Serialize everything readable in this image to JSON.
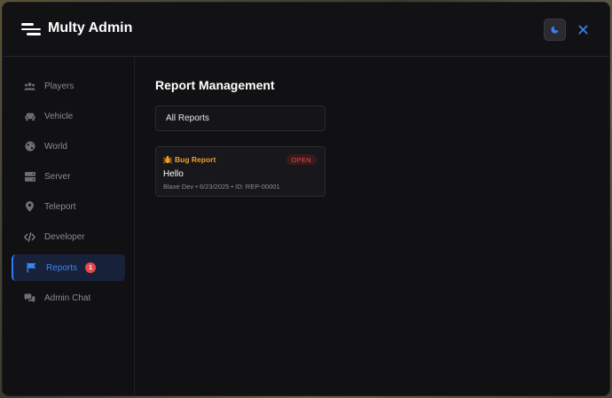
{
  "app": {
    "title": "Multy Admin"
  },
  "sidebar": {
    "items": [
      {
        "label": "Players",
        "icon": "users-icon"
      },
      {
        "label": "Vehicle",
        "icon": "car-icon"
      },
      {
        "label": "World",
        "icon": "globe-icon"
      },
      {
        "label": "Server",
        "icon": "server-icon"
      },
      {
        "label": "Teleport",
        "icon": "map-pin-icon"
      },
      {
        "label": "Developer",
        "icon": "code-icon"
      },
      {
        "label": "Reports",
        "icon": "flag-icon",
        "badge": "1",
        "active": true
      },
      {
        "label": "Admin Chat",
        "icon": "chat-icon"
      }
    ]
  },
  "main": {
    "title": "Report Management",
    "filter": {
      "selected": "All Reports"
    },
    "reports": [
      {
        "type": "Bug Report",
        "type_icon": "bug-icon",
        "status": "OPEN",
        "title": "Hello",
        "meta": "Blaxe Dev • 6/23/2025 • ID: REP-00001"
      }
    ]
  },
  "colors": {
    "accent": "#3b82f6",
    "bug": "#f0a020",
    "status_open": "#e5484d",
    "badge": "#e5484d"
  }
}
